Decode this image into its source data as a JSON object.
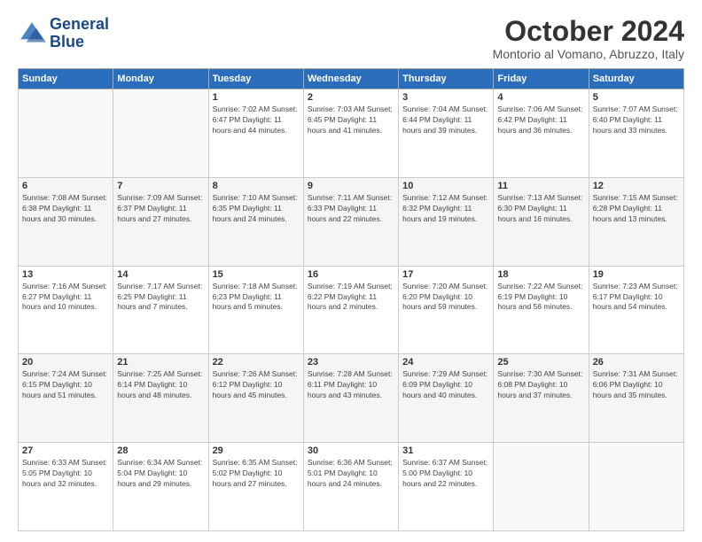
{
  "logo": {
    "line1": "General",
    "line2": "Blue"
  },
  "title": "October 2024",
  "subtitle": "Montorio al Vomano, Abruzzo, Italy",
  "days_of_week": [
    "Sunday",
    "Monday",
    "Tuesday",
    "Wednesday",
    "Thursday",
    "Friday",
    "Saturday"
  ],
  "weeks": [
    [
      {
        "day": "",
        "info": ""
      },
      {
        "day": "",
        "info": ""
      },
      {
        "day": "1",
        "info": "Sunrise: 7:02 AM\nSunset: 6:47 PM\nDaylight: 11 hours and 44 minutes."
      },
      {
        "day": "2",
        "info": "Sunrise: 7:03 AM\nSunset: 6:45 PM\nDaylight: 11 hours and 41 minutes."
      },
      {
        "day": "3",
        "info": "Sunrise: 7:04 AM\nSunset: 6:44 PM\nDaylight: 11 hours and 39 minutes."
      },
      {
        "day": "4",
        "info": "Sunrise: 7:06 AM\nSunset: 6:42 PM\nDaylight: 11 hours and 36 minutes."
      },
      {
        "day": "5",
        "info": "Sunrise: 7:07 AM\nSunset: 6:40 PM\nDaylight: 11 hours and 33 minutes."
      }
    ],
    [
      {
        "day": "6",
        "info": "Sunrise: 7:08 AM\nSunset: 6:38 PM\nDaylight: 11 hours and 30 minutes."
      },
      {
        "day": "7",
        "info": "Sunrise: 7:09 AM\nSunset: 6:37 PM\nDaylight: 11 hours and 27 minutes."
      },
      {
        "day": "8",
        "info": "Sunrise: 7:10 AM\nSunset: 6:35 PM\nDaylight: 11 hours and 24 minutes."
      },
      {
        "day": "9",
        "info": "Sunrise: 7:11 AM\nSunset: 6:33 PM\nDaylight: 11 hours and 22 minutes."
      },
      {
        "day": "10",
        "info": "Sunrise: 7:12 AM\nSunset: 6:32 PM\nDaylight: 11 hours and 19 minutes."
      },
      {
        "day": "11",
        "info": "Sunrise: 7:13 AM\nSunset: 6:30 PM\nDaylight: 11 hours and 16 minutes."
      },
      {
        "day": "12",
        "info": "Sunrise: 7:15 AM\nSunset: 6:28 PM\nDaylight: 11 hours and 13 minutes."
      }
    ],
    [
      {
        "day": "13",
        "info": "Sunrise: 7:16 AM\nSunset: 6:27 PM\nDaylight: 11 hours and 10 minutes."
      },
      {
        "day": "14",
        "info": "Sunrise: 7:17 AM\nSunset: 6:25 PM\nDaylight: 11 hours and 7 minutes."
      },
      {
        "day": "15",
        "info": "Sunrise: 7:18 AM\nSunset: 6:23 PM\nDaylight: 11 hours and 5 minutes."
      },
      {
        "day": "16",
        "info": "Sunrise: 7:19 AM\nSunset: 6:22 PM\nDaylight: 11 hours and 2 minutes."
      },
      {
        "day": "17",
        "info": "Sunrise: 7:20 AM\nSunset: 6:20 PM\nDaylight: 10 hours and 59 minutes."
      },
      {
        "day": "18",
        "info": "Sunrise: 7:22 AM\nSunset: 6:19 PM\nDaylight: 10 hours and 56 minutes."
      },
      {
        "day": "19",
        "info": "Sunrise: 7:23 AM\nSunset: 6:17 PM\nDaylight: 10 hours and 54 minutes."
      }
    ],
    [
      {
        "day": "20",
        "info": "Sunrise: 7:24 AM\nSunset: 6:15 PM\nDaylight: 10 hours and 51 minutes."
      },
      {
        "day": "21",
        "info": "Sunrise: 7:25 AM\nSunset: 6:14 PM\nDaylight: 10 hours and 48 minutes."
      },
      {
        "day": "22",
        "info": "Sunrise: 7:26 AM\nSunset: 6:12 PM\nDaylight: 10 hours and 45 minutes."
      },
      {
        "day": "23",
        "info": "Sunrise: 7:28 AM\nSunset: 6:11 PM\nDaylight: 10 hours and 43 minutes."
      },
      {
        "day": "24",
        "info": "Sunrise: 7:29 AM\nSunset: 6:09 PM\nDaylight: 10 hours and 40 minutes."
      },
      {
        "day": "25",
        "info": "Sunrise: 7:30 AM\nSunset: 6:08 PM\nDaylight: 10 hours and 37 minutes."
      },
      {
        "day": "26",
        "info": "Sunrise: 7:31 AM\nSunset: 6:06 PM\nDaylight: 10 hours and 35 minutes."
      }
    ],
    [
      {
        "day": "27",
        "info": "Sunrise: 6:33 AM\nSunset: 5:05 PM\nDaylight: 10 hours and 32 minutes."
      },
      {
        "day": "28",
        "info": "Sunrise: 6:34 AM\nSunset: 5:04 PM\nDaylight: 10 hours and 29 minutes."
      },
      {
        "day": "29",
        "info": "Sunrise: 6:35 AM\nSunset: 5:02 PM\nDaylight: 10 hours and 27 minutes."
      },
      {
        "day": "30",
        "info": "Sunrise: 6:36 AM\nSunset: 5:01 PM\nDaylight: 10 hours and 24 minutes."
      },
      {
        "day": "31",
        "info": "Sunrise: 6:37 AM\nSunset: 5:00 PM\nDaylight: 10 hours and 22 minutes."
      },
      {
        "day": "",
        "info": ""
      },
      {
        "day": "",
        "info": ""
      }
    ]
  ]
}
